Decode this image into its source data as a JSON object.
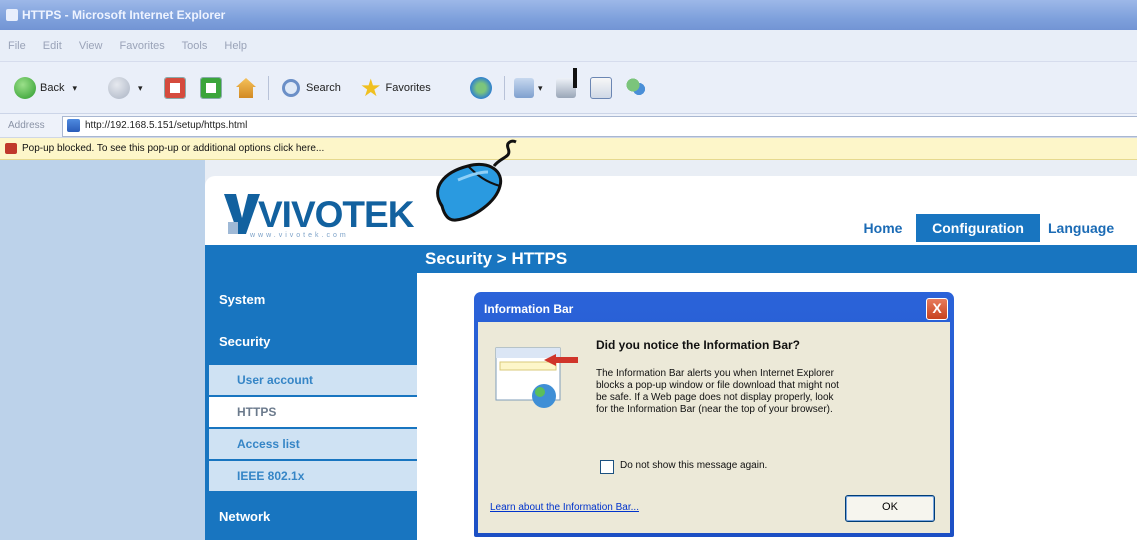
{
  "window": {
    "title": "HTTPS - Microsoft Internet Explorer",
    "menu": [
      "File",
      "Edit",
      "View",
      "Favorites",
      "Tools",
      "Help"
    ]
  },
  "toolbar": {
    "back_label": "Back",
    "search_label": "Search",
    "favorites_label": "Favorites"
  },
  "addressbar": {
    "label": "Address",
    "url": "http://192.168.5.151/setup/https.html"
  },
  "infobar": {
    "text": "Pop-up blocked. To see this pop-up or additional options click here..."
  },
  "page": {
    "logo_text": "VIVOTEK",
    "logo_sub": "www.vivotek.com",
    "nav": {
      "home": "Home",
      "configuration": "Configuration",
      "language": "Language"
    },
    "breadcrumb": "Security > HTTPS",
    "sidebar": {
      "system": "System",
      "security": "Security",
      "items": [
        "User account",
        "HTTPS",
        "Access list",
        "IEEE 802.1x"
      ],
      "network": "Network"
    }
  },
  "dialog": {
    "title": "Information Bar",
    "close": "X",
    "heading": "Did you notice the Information Bar?",
    "body": "The Information Bar alerts you when Internet Explorer blocks a pop-up window or file download that might not be safe. If a Web page does not display properly, look for the Information Bar (near the top of your browser).",
    "checkbox_label": "Do not show this message again.",
    "link": "Learn about the Information Bar...",
    "ok": "OK"
  }
}
